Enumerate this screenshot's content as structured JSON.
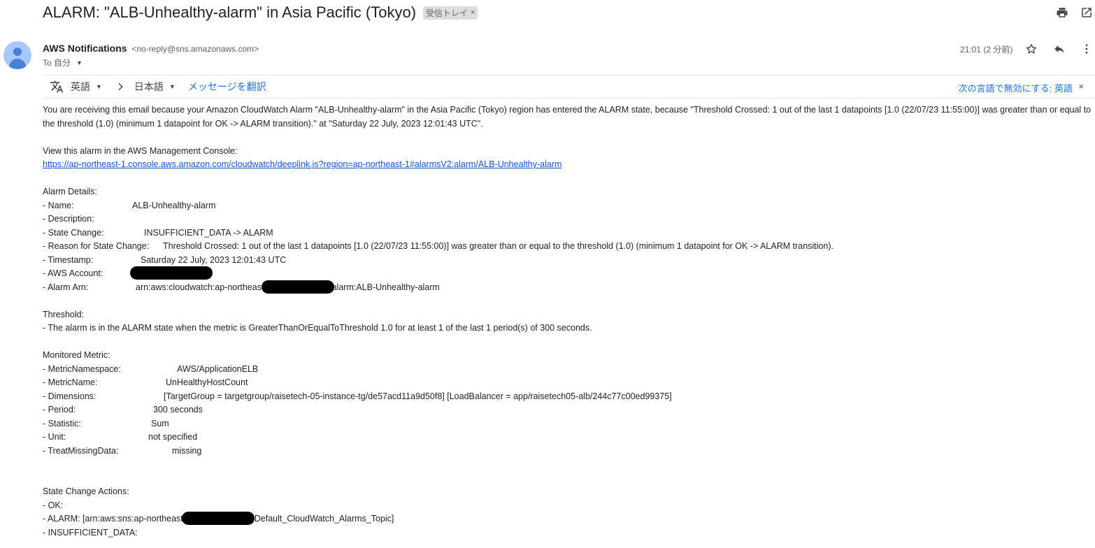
{
  "header": {
    "subject": "ALARM: \"ALB-Unhealthy-alarm\" in Asia Pacific (Tokyo)",
    "label": "受信トレイ",
    "label_remove": "×",
    "icons": [
      "print-icon",
      "open-in-new-window-icon"
    ]
  },
  "message": {
    "sender_name": "AWS Notifications",
    "sender_email": "<no-reply@sns.amazonaws.com>",
    "to_label": "To 自分",
    "time": "21:01 (2 分前)",
    "icons": [
      "star-icon",
      "reply-icon",
      "more-vert-icon"
    ]
  },
  "translate_bar": {
    "source_lang": "英語",
    "target_lang": "日本語",
    "translate_link": "メッセージを翻訳",
    "disable_link": "次の言語で無効にする: 英語",
    "close": "×"
  },
  "body": {
    "intro": "You are receiving this email because your Amazon CloudWatch Alarm \"ALB-Unhealthy-alarm\" in the Asia Pacific (Tokyo) region has entered the ALARM state, because \"Threshold Crossed: 1 out of the last 1 datapoints [1.0 (22/07/23 11:55:00)] was greater than or equal to the threshold (1.0) (minimum 1 datapoint for OK -> ALARM transition).\" at \"Saturday 22 July, 2023 12:01:43 UTC\".",
    "console_heading": "View this alarm in the AWS Management Console:",
    "console_url": "https://ap-northeast-1.console.aws.amazon.com/cloudwatch/deeplink.js?region=ap-northeast-1#alarmsV2:alarm/ALB-Unhealthy-alarm",
    "details_heading": "Alarm Details:",
    "details": [
      {
        "key": "- Name:",
        "value": "ALB-Unhealthy-alarm"
      },
      {
        "key": "- Description:",
        "value": ""
      },
      {
        "key": "- State Change:",
        "value": "INSUFFICIENT_DATA -> ALARM"
      },
      {
        "key": "- Reason for State Change:",
        "value": "Threshold Crossed: 1 out of the last 1 datapoints [1.0 (22/07/23 11:55:00)] was greater than or equal to the threshold (1.0) (minimum 1 datapoint for OK -> ALARM transition)."
      },
      {
        "key": "- Timestamp:",
        "value": "Saturday 22 July, 2023 12:01:43 UTC"
      },
      {
        "key": "- AWS Account:",
        "value": ""
      },
      {
        "key": "- Alarm Arn:",
        "value_prefix": "arn:aws:cloudwatch:ap-northeast-",
        "value_suffix": "alarm:ALB-Unhealthy-alarm"
      }
    ],
    "threshold_heading": "Threshold:",
    "threshold_text": "- The alarm is in the ALARM state when the metric is GreaterThanOrEqualToThreshold 1.0 for at least 1 of the last 1 period(s) of 300 seconds.",
    "metric_heading": "Monitored Metric:",
    "metric": [
      {
        "key": "- MetricNamespace:",
        "value": "AWS/ApplicationELB"
      },
      {
        "key": "- MetricName:",
        "value": "UnHealthyHostCount"
      },
      {
        "key": "- Dimensions:",
        "value": "[TargetGroup = targetgroup/raisetech-05-instance-tg/de57acd11a9d50f8] [LoadBalancer = app/raisetech05-alb/244c77c00ed99375]"
      },
      {
        "key": "- Period:",
        "value": "300 seconds"
      },
      {
        "key": "- Statistic:",
        "value": "Sum"
      },
      {
        "key": "- Unit:",
        "value": "not specified"
      },
      {
        "key": "- TreatMissingData:",
        "value": "missing"
      }
    ],
    "actions_heading": "State Change Actions:",
    "actions": {
      "ok": "- OK:",
      "alarm_prefix": "- ALARM: [arn:aws:sns:ap-northeast",
      "alarm_suffix": "Default_CloudWatch_Alarms_Topic]",
      "insufficient": "- INSUFFICIENT_DATA:"
    }
  },
  "colors": {
    "link": "#1155cc",
    "accent": "#1a73e8",
    "avatar_bg": "#a8c7fa",
    "avatar_fg": "#4a7fd6",
    "redaction": "#000000"
  }
}
